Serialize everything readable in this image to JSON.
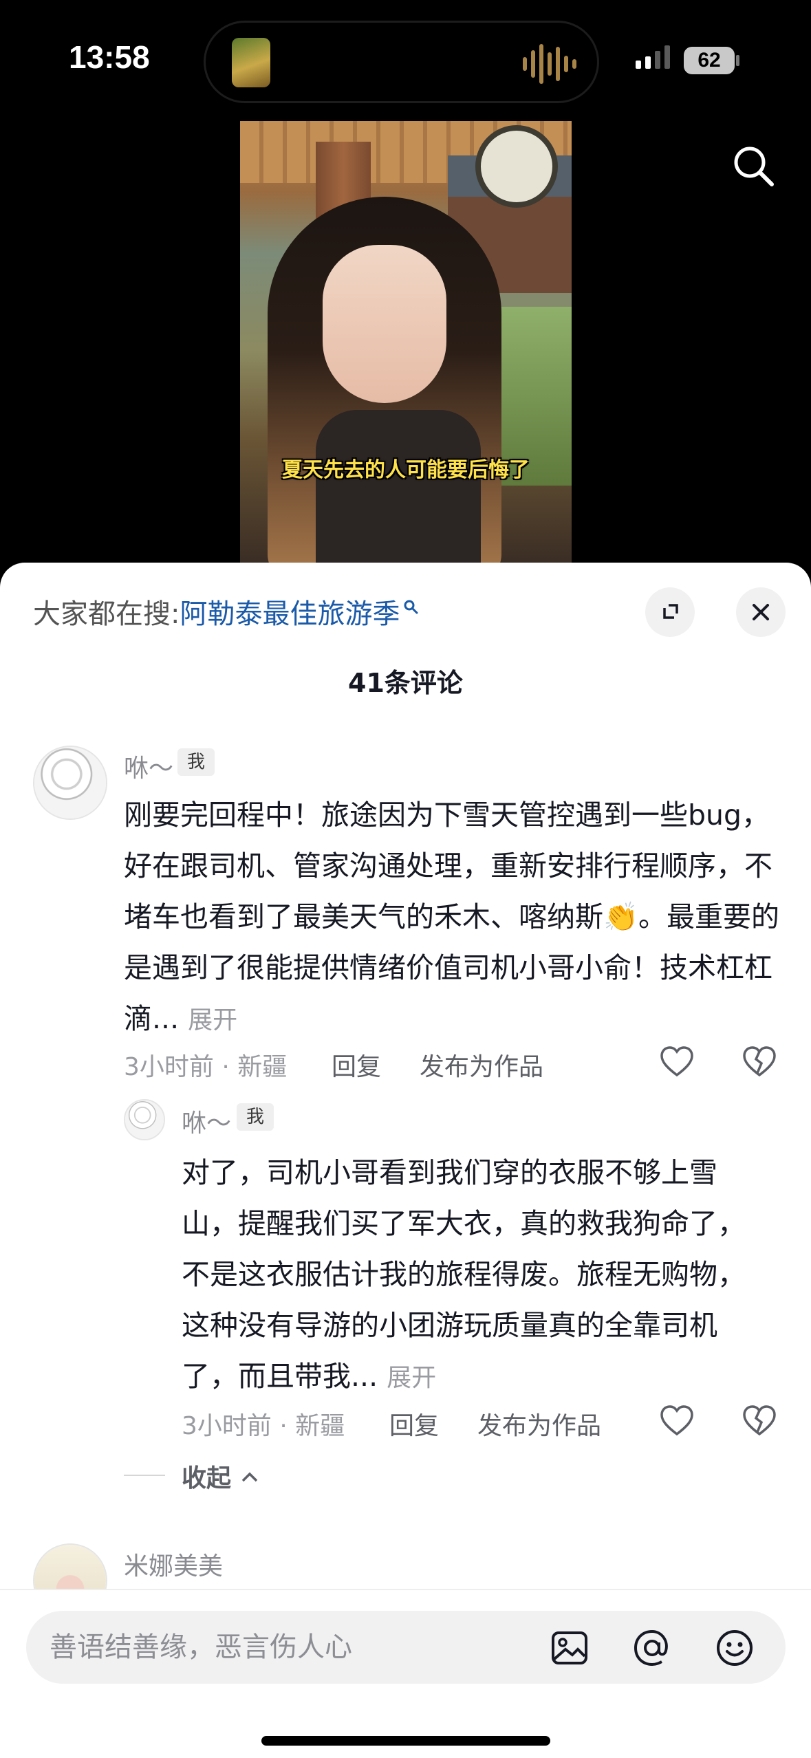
{
  "status_bar": {
    "time": "13:58",
    "battery": "62"
  },
  "video": {
    "caption": "夏天先去的人可能要后悔了"
  },
  "comments_panel": {
    "hot_search_prefix": "大家都在搜:",
    "hot_search_term": "阿勒泰最佳旅游季",
    "comment_count": "41条评论",
    "comments": [
      {
        "username": "咻～",
        "tag": "我",
        "text": "刚要完回程中！旅途因为下雪天管控遇到一些bug，好在跟司机、管家沟通处理，重新安排行程顺序，不堵车也看到了最美天气的禾木、喀纳斯👏。最重要的是遇到了很能提供情绪价值司机小哥小俞！技术杠杠滴...",
        "expand": "展开",
        "meta": "3小时前 · 新疆",
        "reply": "回复",
        "publish": "发布为作品"
      },
      {
        "username": "咻～",
        "tag": "我",
        "text": "对了，司机小哥看到我们穿的衣服不够上雪山，提醒我们买了军大衣，真的救我狗命了，不是这衣服估计我的旅程得废。旅程无购物，这种没有导游的小团游玩质量真的全靠司机了，而且带我...",
        "expand": "展开",
        "meta": "3小时前 · 新疆",
        "reply": "回复",
        "publish": "发布为作品"
      },
      {
        "username": "米娜美美"
      }
    ],
    "collapse": "收起"
  },
  "input_bar": {
    "placeholder": "善语结善缘，恶言伤人心"
  },
  "colors": {
    "link": "#1a5aa8",
    "caption": "#ffe14a",
    "muted": "#9a9ba1"
  },
  "icons": [
    "search-icon",
    "expand-icon",
    "close-icon",
    "heart-icon",
    "dislike-icon",
    "image-icon",
    "at-icon",
    "emoji-icon"
  ]
}
